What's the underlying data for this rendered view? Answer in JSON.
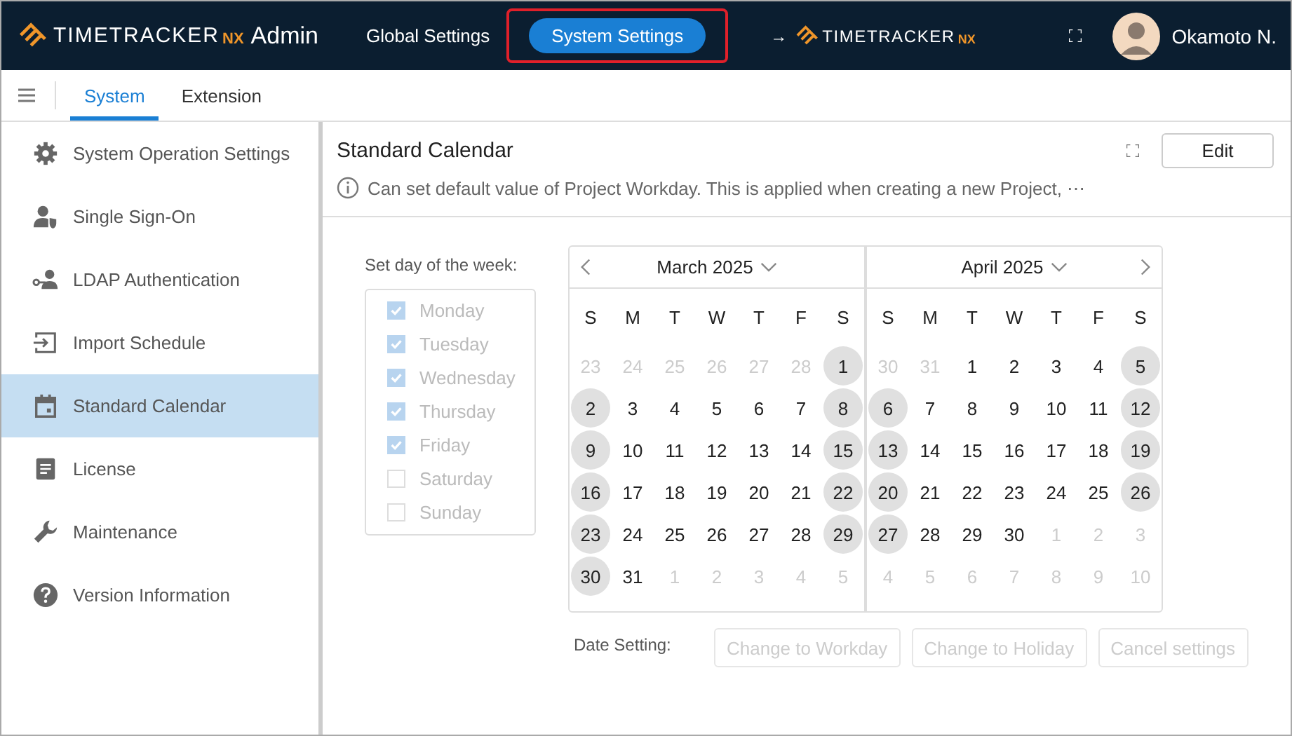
{
  "header": {
    "logo": {
      "brand": "TIMETRACKER",
      "suffix": "NX",
      "product": "Admin"
    },
    "nav": [
      {
        "label": "Global Settings",
        "selected": false,
        "highlighted": false
      },
      {
        "label": "System Settings",
        "selected": true,
        "highlighted": true
      }
    ],
    "arrow": "→",
    "app_logo": {
      "brand": "TIMETRACKER",
      "suffix": "NX"
    },
    "user": "Okamoto N."
  },
  "tabs": [
    {
      "label": "System",
      "selected": true
    },
    {
      "label": "Extension",
      "selected": false
    }
  ],
  "sidebar": {
    "items": [
      {
        "label": "System Operation Settings",
        "kind": "gear",
        "selected": false
      },
      {
        "label": "Single Sign-On",
        "kind": "shield",
        "selected": false
      },
      {
        "label": "LDAP Authentication",
        "kind": "key",
        "selected": false
      },
      {
        "label": "Import Schedule",
        "kind": "import",
        "selected": false
      },
      {
        "label": "Standard Calendar",
        "kind": "calendar",
        "selected": true
      },
      {
        "label": "License",
        "kind": "document",
        "selected": false
      },
      {
        "label": "Maintenance",
        "kind": "wrench",
        "selected": false
      },
      {
        "label": "Version Information",
        "kind": "help",
        "selected": false
      }
    ]
  },
  "panel": {
    "title": "Standard Calendar",
    "edit_button": "Edit",
    "info": "Can set default value of Project Workday. This is applied when creating a new Project, ⋯",
    "weekdays": {
      "label": "Set day of the week:",
      "disabled": true,
      "days": [
        {
          "label": "Monday",
          "checked": true
        },
        {
          "label": "Tuesday",
          "checked": true
        },
        {
          "label": "Wednesday",
          "checked": true
        },
        {
          "label": "Thursday",
          "checked": true
        },
        {
          "label": "Friday",
          "checked": true
        },
        {
          "label": "Saturday",
          "checked": false
        },
        {
          "label": "Sunday",
          "checked": false
        }
      ]
    },
    "calendars": [
      {
        "month": "March 2025",
        "kind": "prev",
        "headers": [
          "S",
          "M",
          "T",
          "W",
          "T",
          "F",
          "S"
        ],
        "weeks": [
          [
            {
              "d": "23",
              "kind": "outside"
            },
            {
              "d": "24",
              "kind": "outside"
            },
            {
              "d": "25",
              "kind": "outside"
            },
            {
              "d": "26",
              "kind": "outside"
            },
            {
              "d": "27",
              "kind": "outside"
            },
            {
              "d": "28",
              "kind": "outside"
            },
            {
              "d": "1",
              "kind": "holiday"
            }
          ],
          [
            {
              "d": "2",
              "kind": "holiday"
            },
            {
              "d": "3",
              "kind": "workday"
            },
            {
              "d": "4",
              "kind": "workday"
            },
            {
              "d": "5",
              "kind": "workday"
            },
            {
              "d": "6",
              "kind": "workday"
            },
            {
              "d": "7",
              "kind": "workday"
            },
            {
              "d": "8",
              "kind": "holiday"
            }
          ],
          [
            {
              "d": "9",
              "kind": "holiday"
            },
            {
              "d": "10",
              "kind": "workday"
            },
            {
              "d": "11",
              "kind": "workday"
            },
            {
              "d": "12",
              "kind": "workday"
            },
            {
              "d": "13",
              "kind": "workday"
            },
            {
              "d": "14",
              "kind": "workday"
            },
            {
              "d": "15",
              "kind": "holiday"
            }
          ],
          [
            {
              "d": "16",
              "kind": "holiday"
            },
            {
              "d": "17",
              "kind": "workday"
            },
            {
              "d": "18",
              "kind": "workday"
            },
            {
              "d": "19",
              "kind": "workday"
            },
            {
              "d": "20",
              "kind": "workday"
            },
            {
              "d": "21",
              "kind": "workday"
            },
            {
              "d": "22",
              "kind": "holiday"
            }
          ],
          [
            {
              "d": "23",
              "kind": "holiday"
            },
            {
              "d": "24",
              "kind": "workday"
            },
            {
              "d": "25",
              "kind": "workday"
            },
            {
              "d": "26",
              "kind": "workday"
            },
            {
              "d": "27",
              "kind": "workday"
            },
            {
              "d": "28",
              "kind": "workday"
            },
            {
              "d": "29",
              "kind": "holiday"
            }
          ],
          [
            {
              "d": "30",
              "kind": "holiday"
            },
            {
              "d": "31",
              "kind": "workday"
            },
            {
              "d": "1",
              "kind": "outside"
            },
            {
              "d": "2",
              "kind": "outside"
            },
            {
              "d": "3",
              "kind": "outside"
            },
            {
              "d": "4",
              "kind": "outside"
            },
            {
              "d": "5",
              "kind": "outside"
            }
          ]
        ]
      },
      {
        "month": "April 2025",
        "kind": "next",
        "headers": [
          "S",
          "M",
          "T",
          "W",
          "T",
          "F",
          "S"
        ],
        "weeks": [
          [
            {
              "d": "30",
              "kind": "outside"
            },
            {
              "d": "31",
              "kind": "outside"
            },
            {
              "d": "1",
              "kind": "workday"
            },
            {
              "d": "2",
              "kind": "workday"
            },
            {
              "d": "3",
              "kind": "workday"
            },
            {
              "d": "4",
              "kind": "workday"
            },
            {
              "d": "5",
              "kind": "holiday"
            }
          ],
          [
            {
              "d": "6",
              "kind": "holiday"
            },
            {
              "d": "7",
              "kind": "workday"
            },
            {
              "d": "8",
              "kind": "workday"
            },
            {
              "d": "9",
              "kind": "workday"
            },
            {
              "d": "10",
              "kind": "workday"
            },
            {
              "d": "11",
              "kind": "workday"
            },
            {
              "d": "12",
              "kind": "holiday"
            }
          ],
          [
            {
              "d": "13",
              "kind": "holiday"
            },
            {
              "d": "14",
              "kind": "workday"
            },
            {
              "d": "15",
              "kind": "workday"
            },
            {
              "d": "16",
              "kind": "workday"
            },
            {
              "d": "17",
              "kind": "workday"
            },
            {
              "d": "18",
              "kind": "workday"
            },
            {
              "d": "19",
              "kind": "holiday"
            }
          ],
          [
            {
              "d": "20",
              "kind": "holiday"
            },
            {
              "d": "21",
              "kind": "workday"
            },
            {
              "d": "22",
              "kind": "workday"
            },
            {
              "d": "23",
              "kind": "workday"
            },
            {
              "d": "24",
              "kind": "workday"
            },
            {
              "d": "25",
              "kind": "workday"
            },
            {
              "d": "26",
              "kind": "holiday"
            }
          ],
          [
            {
              "d": "27",
              "kind": "holiday"
            },
            {
              "d": "28",
              "kind": "workday"
            },
            {
              "d": "29",
              "kind": "workday"
            },
            {
              "d": "30",
              "kind": "workday"
            },
            {
              "d": "1",
              "kind": "outside"
            },
            {
              "d": "2",
              "kind": "outside"
            },
            {
              "d": "3",
              "kind": "outside"
            }
          ],
          [
            {
              "d": "4",
              "kind": "outside"
            },
            {
              "d": "5",
              "kind": "outside"
            },
            {
              "d": "6",
              "kind": "outside"
            },
            {
              "d": "7",
              "kind": "outside"
            },
            {
              "d": "8",
              "kind": "outside"
            },
            {
              "d": "9",
              "kind": "outside"
            },
            {
              "d": "10",
              "kind": "outside"
            }
          ]
        ]
      }
    ],
    "date_setting": {
      "label": "Date Setting:",
      "buttons": [
        {
          "label": "Change to Workday",
          "disabled": true
        },
        {
          "label": "Change to Holiday",
          "disabled": true
        },
        {
          "label": "Cancel settings",
          "disabled": true
        }
      ]
    }
  }
}
